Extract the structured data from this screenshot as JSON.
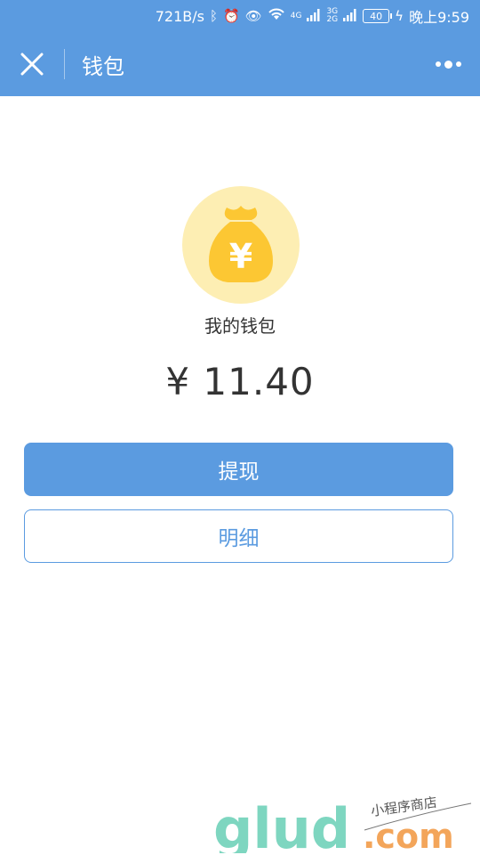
{
  "status_bar": {
    "speed": "721B/s",
    "net_4g": "4G",
    "net_3g": "3G",
    "net_2g": "2G",
    "battery": "40",
    "time": "晚上9:59"
  },
  "nav": {
    "title": "钱包"
  },
  "wallet": {
    "label": "我的钱包",
    "currency_symbol": "¥",
    "balance": "¥ 11.40"
  },
  "actions": {
    "withdraw_label": "提现",
    "detail_label": "明细"
  },
  "watermark": {
    "brand": "glud",
    "domain": ".com",
    "tagline": "小程序商店"
  },
  "colors": {
    "primary": "#5b9be0",
    "coin_bg": "#fdeeb3",
    "coin_bag": "#fcc733"
  }
}
